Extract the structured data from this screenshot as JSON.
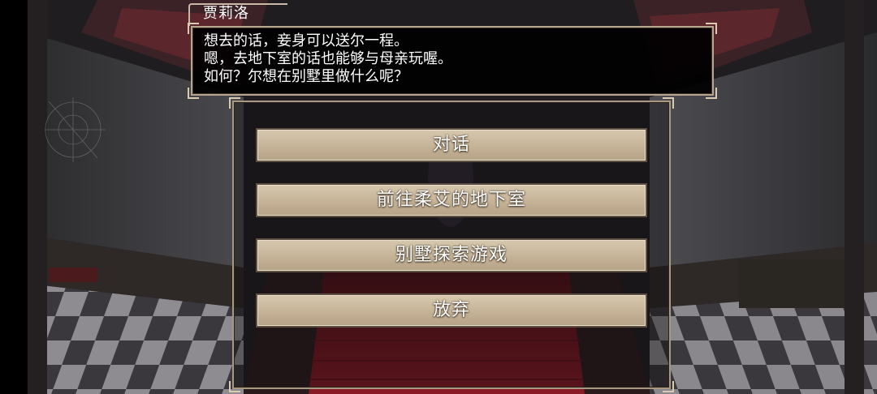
{
  "speaker": {
    "name": "贾莉洛"
  },
  "dialogue": {
    "lines": [
      "想去的话，妾身可以送尔一程。",
      "嗯，去地下室的话也能够与母亲玩喔。",
      "如何？尔想在别墅里做什么呢？"
    ]
  },
  "choices": [
    {
      "label": "对话"
    },
    {
      "label": "前往柔艾的地下室"
    },
    {
      "label": "别墅探索游戏"
    },
    {
      "label": "放弃"
    }
  ],
  "colors": {
    "frame": "#b6a690",
    "button_fill": "#c8b79b",
    "carpet": "#7a1822",
    "text": "#ffffff"
  }
}
